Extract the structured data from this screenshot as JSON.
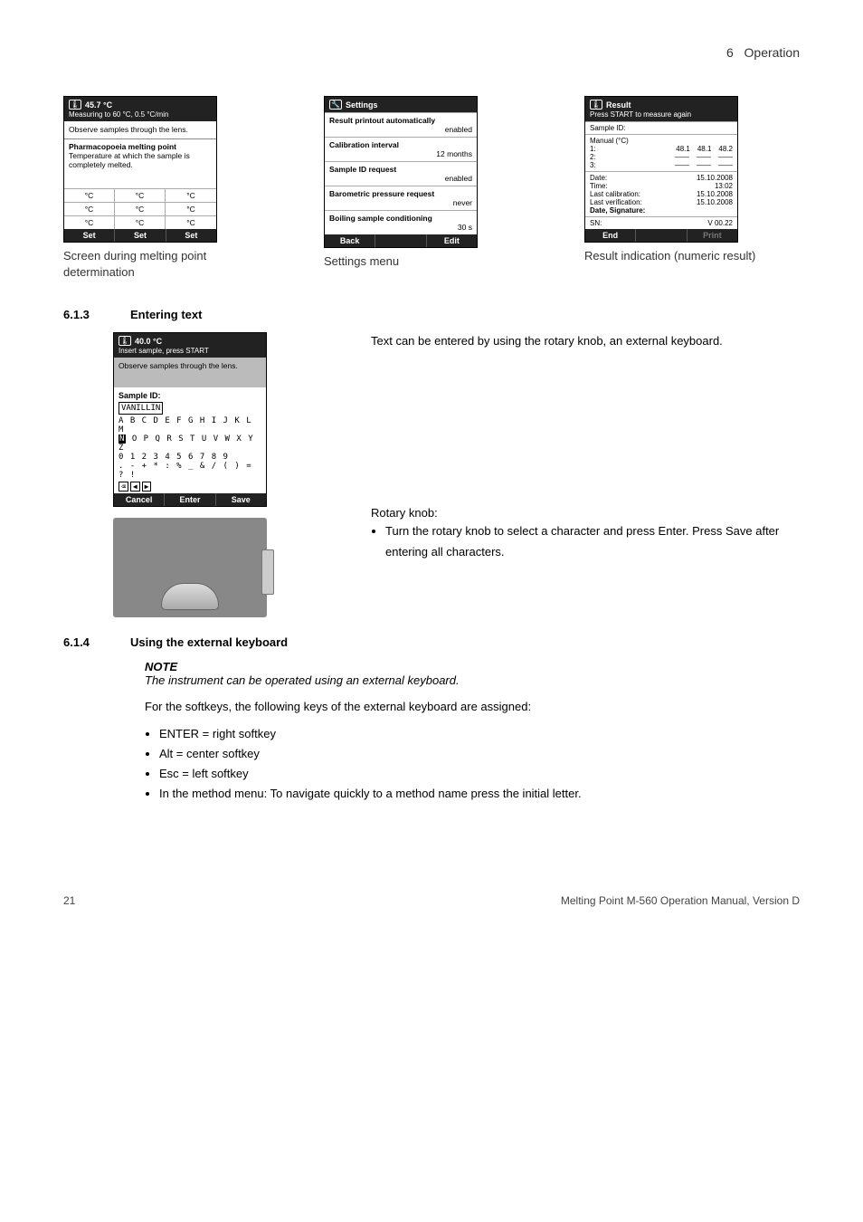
{
  "header": {
    "chapter": "6",
    "chapter_title": "Operation"
  },
  "screens": {
    "melting": {
      "temp": "45.7 °C",
      "sub": "Measuring to 60 °C, 0.5 °C/min",
      "observe": "Observe samples through the lens.",
      "mp_title": "Pharmacopoeia melting point",
      "mp_desc": "Temperature at which the sample is completely melted.",
      "unit": "°C",
      "footer": "Set",
      "caption": "Screen during melting point determination"
    },
    "settings": {
      "title": "Settings",
      "rows": [
        {
          "label": "Result printout automatically",
          "value": "enabled"
        },
        {
          "label": "Calibration interval",
          "value": "12 months"
        },
        {
          "label": "Sample ID request",
          "value": "enabled"
        },
        {
          "label": "Barometric pressure request",
          "value": "never"
        },
        {
          "label": "Boiling sample conditioning",
          "value": "30 s"
        }
      ],
      "back": "Back",
      "edit": "Edit",
      "caption": "Settings menu"
    },
    "result": {
      "title": "Result",
      "sub": "Press START to measure again",
      "sample_id": "Sample ID:",
      "manual": "Manual (°C)",
      "r1": "1:",
      "v1a": "48.1",
      "v1b": "48.1",
      "v1c": "48.2",
      "r2": "2:",
      "r3": "3:",
      "date_l": "Date:",
      "date_v": "15.10.2008",
      "time_l": "Time:",
      "time_v": "13:02",
      "lcal_l": "Last calibration:",
      "lcal_v": "15.10.2008",
      "lver_l": "Last verification:",
      "lver_v": "15.10.2008",
      "sig": "Date, Signature:",
      "sn_l": "SN:",
      "sn_v": "V 00.22",
      "end": "End",
      "print": "Print",
      "caption": "Result indication (numeric result)"
    },
    "textentry": {
      "temp": "40.0 °C",
      "sub": "Insert sample, press START",
      "observe": "Observe samples through the lens.",
      "sid_label": "Sample ID:",
      "sid_value": "VANILLIN",
      "row1": "A B C D E F G H I J K L M",
      "row2_hl": "N",
      "row2_rest": " O P Q R S T U V W X Y Z",
      "row3": "0 1 2 3 4 5 6 7 8 9",
      "row4": ". - + * : % _ & / ( ) = ? !",
      "cancel": "Cancel",
      "enter": "Enter",
      "save": "Save"
    }
  },
  "sections": {
    "s613_num": "6.1.3",
    "s613_title": "Entering text",
    "s613_intro": "Text can be entered by using the rotary knob, an external keyboard.",
    "knob_head": "Rotary knob:",
    "knob_bullet": "Turn the rotary knob to select a character and press Enter. Press Save after entering all characters.",
    "s614_num": "6.1.4",
    "s614_title": "Using the external keyboard",
    "note_label": "NOTE",
    "note_text": "The instrument can be operated using an external keyboard.",
    "softkeys_intro": "For the softkeys, the following keys of the external keyboard are assigned:",
    "b1": "ENTER = right softkey",
    "b2": "Alt = center softkey",
    "b3": "Esc = left softkey",
    "b4": "In the method menu: To navigate quickly to a method name press the initial letter."
  },
  "footer": {
    "page": "21",
    "doc": "Melting Point M-560 Operation Manual, Version D"
  }
}
